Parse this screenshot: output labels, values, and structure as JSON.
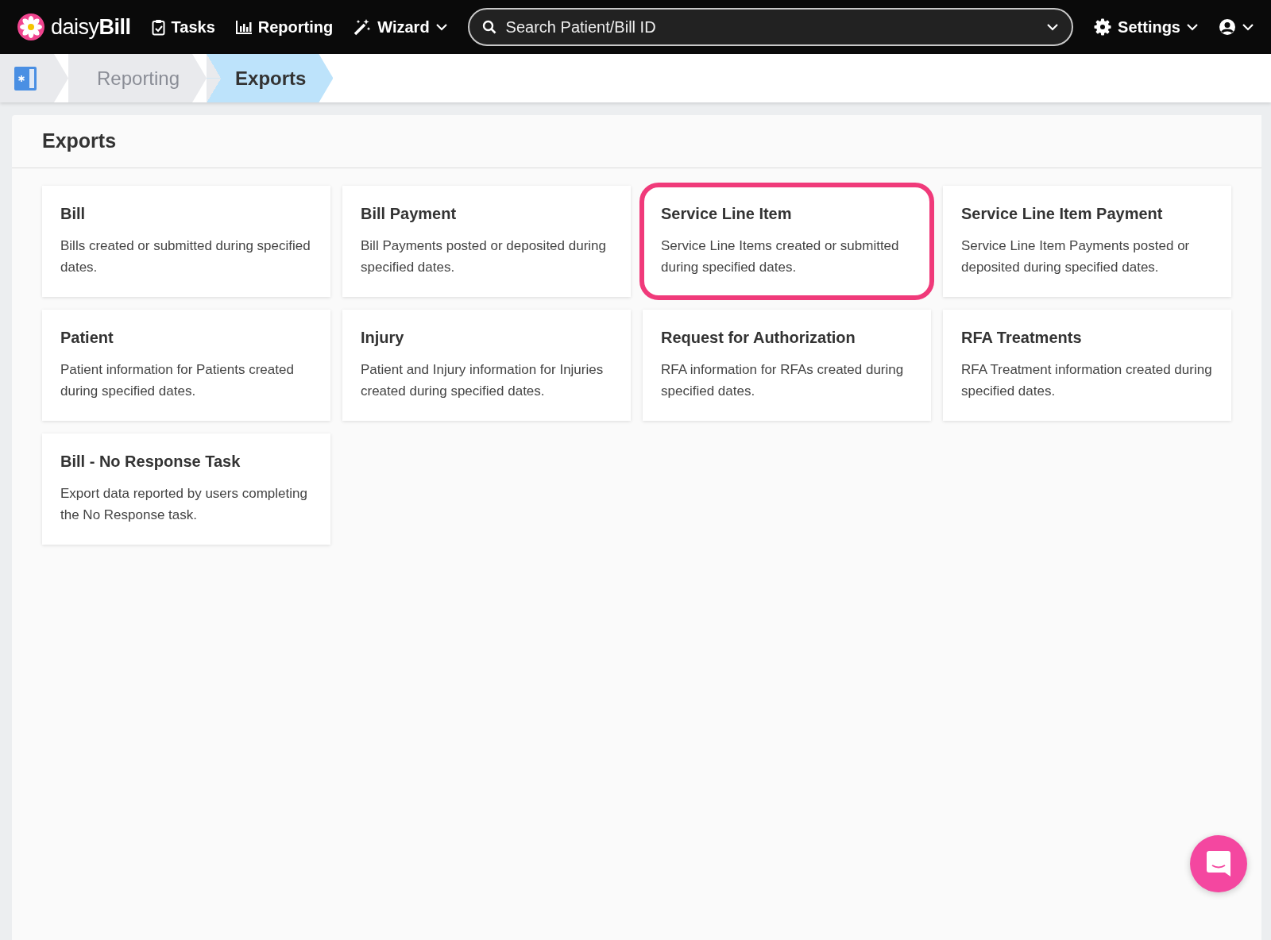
{
  "navbar": {
    "brand": "daisy",
    "brand_bold": "Bill",
    "items": [
      {
        "label": "Tasks",
        "kind": "tasks",
        "dropdown": false
      },
      {
        "label": "Reporting",
        "kind": "reporting",
        "dropdown": false
      },
      {
        "label": "Wizard",
        "kind": "wizard",
        "dropdown": true
      }
    ],
    "search": {
      "placeholder": "Search Patient/Bill ID"
    },
    "settings": {
      "label": "Settings"
    }
  },
  "breadcrumb": [
    {
      "label": "Reporting",
      "selected": false
    },
    {
      "label": "Exports",
      "selected": true
    }
  ],
  "panel": {
    "title": "Exports"
  },
  "cards": [
    {
      "title": "Bill",
      "description": "Bills created or submitted during specified dates.",
      "highlighted": false
    },
    {
      "title": "Bill Payment",
      "description": "Bill Payments posted or deposited during specified dates.",
      "highlighted": false
    },
    {
      "title": "Service Line Item",
      "description": "Service Line Items created or submitted during specified dates.",
      "highlighted": true
    },
    {
      "title": "Service Line Item Payment",
      "description": "Service Line Item Payments posted or deposited during specified dates.",
      "highlighted": false
    },
    {
      "title": "Patient",
      "description": "Patient information for Patients created during specified dates.",
      "highlighted": false
    },
    {
      "title": "Injury",
      "description": "Patient and Injury information for Injuries created during specified dates.",
      "highlighted": false
    },
    {
      "title": "Request for Authorization",
      "description": "RFA information for RFAs created during specified dates.",
      "highlighted": false
    },
    {
      "title": "RFA Treatments",
      "description": "RFA Treatment information created during specified dates.",
      "highlighted": false
    },
    {
      "title": "Bill - No Response Task",
      "description": "Export data reported by users completing the No Response task.",
      "highlighted": false
    }
  ]
}
